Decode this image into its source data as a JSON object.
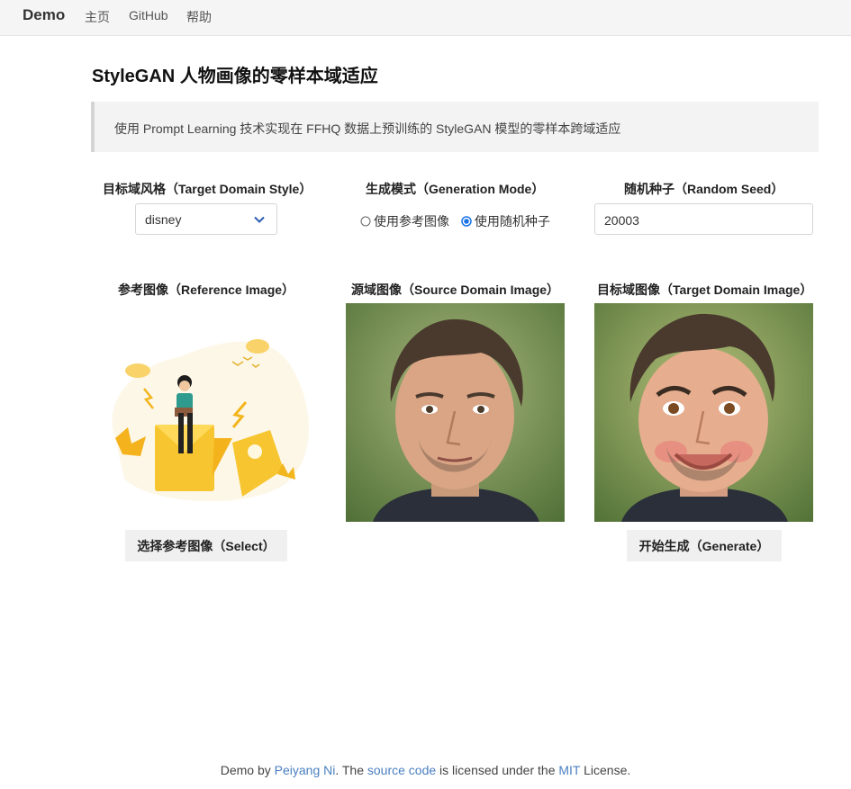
{
  "nav": {
    "brand": "Demo",
    "links": [
      "主页",
      "GitHub",
      "帮助"
    ]
  },
  "page": {
    "title": "StyleGAN 人物画像的零样本域适应",
    "description": "使用 Prompt Learning 技术实现在 FFHQ 数据上预训练的 StyleGAN 模型的零样本跨域适应"
  },
  "controls": {
    "target_style_label": "目标域风格（Target Domain Style）",
    "target_style_value": "disney",
    "mode_label": "生成模式（Generation Mode）",
    "mode_options": [
      "使用参考图像",
      "使用随机种子"
    ],
    "mode_selected": "使用随机种子",
    "seed_label": "随机种子（Random Seed）",
    "seed_value": "20003"
  },
  "images": {
    "reference_label": "参考图像（Reference Image）",
    "source_label": "源域图像（Source Domain Image）",
    "target_label": "目标域图像（Target Domain Image）"
  },
  "buttons": {
    "select": "选择参考图像（Select）",
    "generate": "开始生成（Generate）"
  },
  "footer": {
    "prefix": "Demo by ",
    "author": "Peiyang Ni",
    "mid1": ". The ",
    "source": "source code",
    "mid2": " is licensed under the ",
    "license": "MIT",
    "suffix": " License."
  },
  "colors": {
    "link": "#4a7fc1",
    "radio_selected": "#1a73e8",
    "illustration_yellow": "#f6c52e"
  }
}
